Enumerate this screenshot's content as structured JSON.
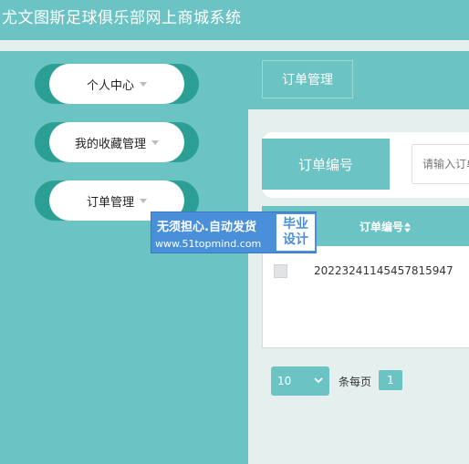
{
  "app": {
    "title": "尤文图斯足球俱乐部网上商城系统"
  },
  "sidebar": {
    "items": [
      {
        "label": "个人中心",
        "icon": "caret-down-icon"
      },
      {
        "label": "我的收藏管理",
        "icon": "caret-down-icon"
      },
      {
        "label": "订单管理",
        "icon": "caret-down-icon"
      }
    ]
  },
  "watermark": {
    "line1": "无须担心.自动发货",
    "line2": "www.51topmind.com",
    "box_line1": "毕业",
    "box_line2": "设计"
  },
  "tab": {
    "label": "订单管理"
  },
  "search": {
    "label": "订单编号",
    "placeholder": "请输入订单编号"
  },
  "table": {
    "columns": [
      {
        "label": "订单编号",
        "icon": "sort-icon"
      }
    ],
    "rows": [
      {
        "checked": false,
        "order_no": "20223241145457815947"
      }
    ]
  },
  "pagination": {
    "page_size": "10",
    "per_page_label": "条每页",
    "current_page": "1"
  },
  "colors": {
    "primary": "#6cc3c3",
    "accent": "#2c9f95",
    "badge": "#4a8fd9",
    "content_bg": "#e5f0ee"
  }
}
